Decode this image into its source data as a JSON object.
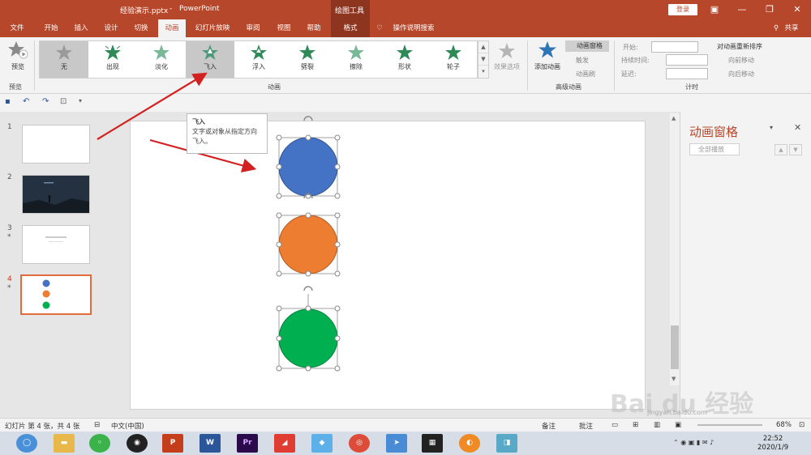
{
  "title": {
    "doc": "经验演示.pptx",
    "sep": "-",
    "app": "PowerPoint",
    "drawing_tools": "绘图工具",
    "signin": "登录",
    "share": "共享"
  },
  "tabs": [
    "文件",
    "开始",
    "插入",
    "设计",
    "切换",
    "动画",
    "幻灯片放映",
    "审阅",
    "视图",
    "帮助",
    "格式"
  ],
  "tell_me": "操作说明搜索",
  "ribbon": {
    "preview": "预览",
    "preview_group": "预览",
    "animations_group": "动画",
    "effects": [
      "无",
      "出现",
      "淡化",
      "飞入",
      "浮入",
      "劈裂",
      "擦除",
      "形状",
      "轮子"
    ],
    "effect_options": "效果选项",
    "add_animation": "添加动画",
    "anim_pane": "动画窗格",
    "trigger": "触发",
    "anim_painter": "动画刷",
    "advanced_group": "高级动画",
    "start": "开始:",
    "duration": "持续时间:",
    "delay": "延迟:",
    "reorder": "对动画重新排序",
    "move_earlier": "向前移动",
    "move_later": "向后移动",
    "timing_group": "计时"
  },
  "tooltip": {
    "title": "飞入",
    "desc": "文字或对象从指定方向飞入。"
  },
  "slides": [
    {
      "num": "1",
      "star": ""
    },
    {
      "num": "2",
      "star": ""
    },
    {
      "num": "3",
      "star": "*"
    },
    {
      "num": "4",
      "star": "*"
    }
  ],
  "shapes_colors": {
    "blue": "#4472c4",
    "orange": "#ed7d31",
    "green": "#00b050"
  },
  "pane": {
    "title": "动画窗格",
    "play_all": "全部播放"
  },
  "status": {
    "slide_info": "幻灯片 第 4 张，共 4 张",
    "lang": "中文(中国)",
    "notes": "备注",
    "comments": "批注",
    "zoom": "68%"
  },
  "clock": {
    "time": "22:52",
    "date": "2020/1/9"
  },
  "watermark": {
    "brand": "Bai du 经验",
    "url": "jingyan.baidu.com"
  }
}
